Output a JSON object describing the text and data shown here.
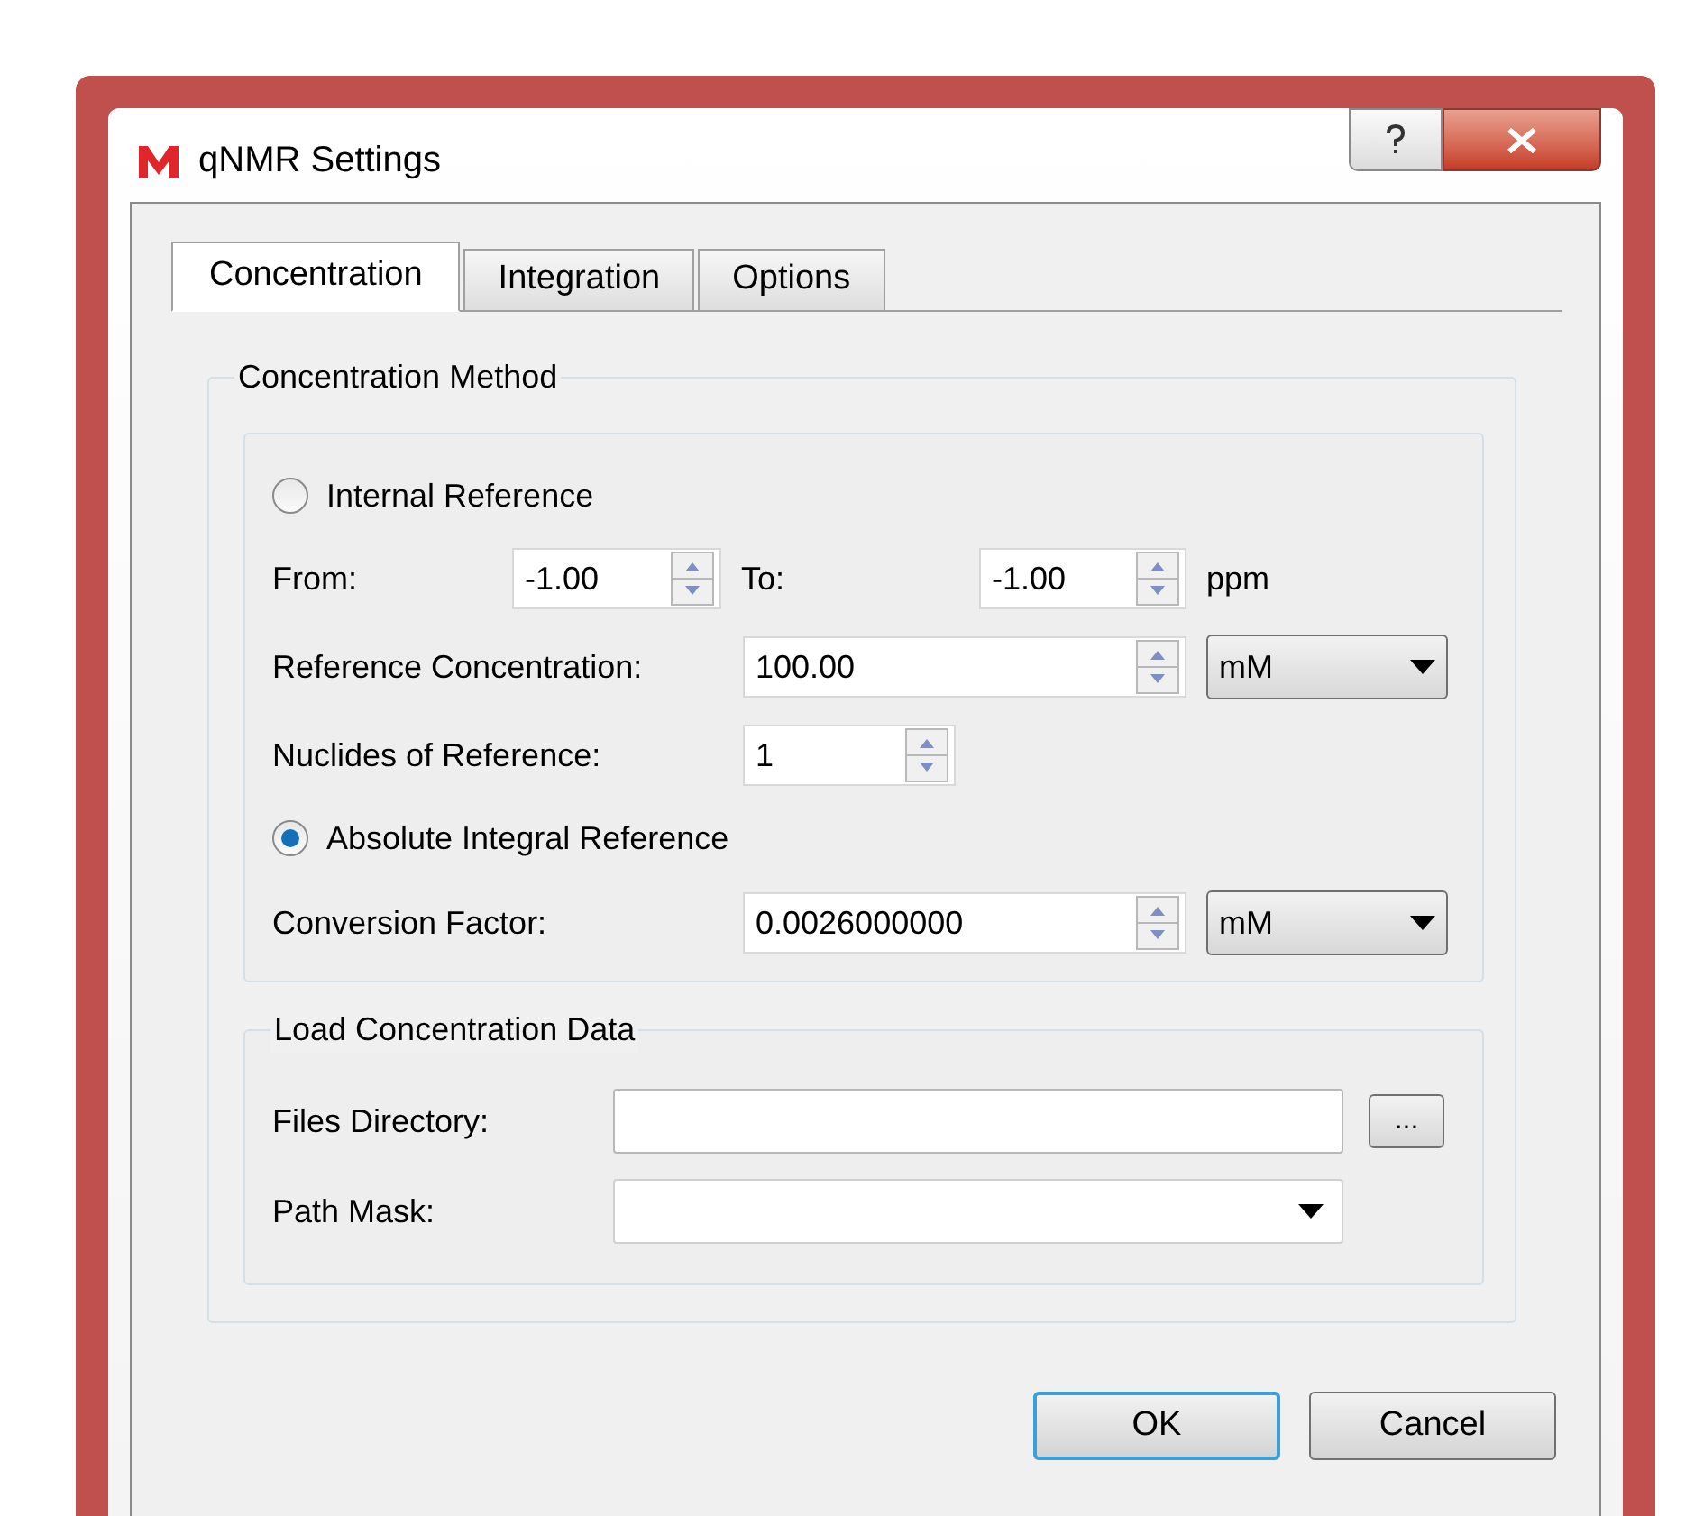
{
  "window": {
    "title": "qNMR Settings"
  },
  "tabs": [
    {
      "label": "Concentration",
      "selected": true
    },
    {
      "label": "Integration",
      "selected": false
    },
    {
      "label": "Options",
      "selected": false
    }
  ],
  "concentration_method": {
    "title": "Concentration Method",
    "internal_reference": {
      "label": "Internal Reference",
      "selected": false
    },
    "from": {
      "label": "From:",
      "value": "-1.00"
    },
    "to": {
      "label": "To:",
      "value": "-1.00",
      "unit": "ppm"
    },
    "reference_concentration": {
      "label": "Reference Concentration:",
      "value": "100.00",
      "unit": "mM"
    },
    "nuclides": {
      "label": "Nuclides of Reference:",
      "value": "1"
    },
    "absolute_integral_reference": {
      "label": "Absolute Integral Reference",
      "selected": true
    },
    "conversion_factor": {
      "label": "Conversion Factor:",
      "value": "0.0026000000",
      "unit": "mM"
    }
  },
  "load_concentration_data": {
    "title": "Load Concentration Data",
    "files_directory": {
      "label": "Files Directory:",
      "browse": "..."
    },
    "path_mask": {
      "label": "Path Mask:"
    }
  },
  "buttons": [
    {
      "label": "OK",
      "default": true
    },
    {
      "label": "Cancel",
      "default": false
    }
  ]
}
